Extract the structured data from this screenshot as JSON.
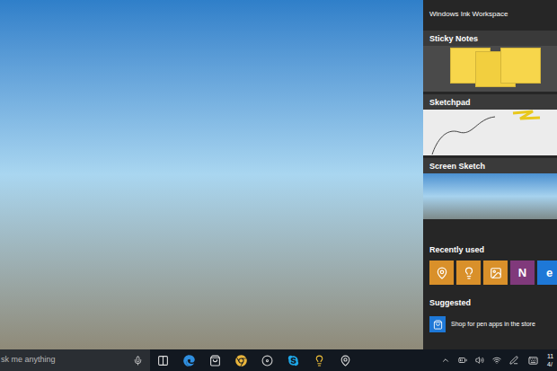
{
  "panel": {
    "title": "Windows Ink Workspace",
    "tiles": [
      {
        "label": "Sticky Notes",
        "kind": "notes"
      },
      {
        "label": "Sketchpad",
        "kind": "sketch"
      },
      {
        "label": "Screen Sketch",
        "kind": "screen"
      }
    ],
    "recently_used": {
      "label": "Recently used",
      "apps": [
        {
          "color": "#d9902a",
          "glyph": ""
        },
        {
          "color": "#d9902a",
          "glyph": ""
        },
        {
          "color": "#d9902a",
          "glyph": ""
        },
        {
          "color": "#80397b",
          "glyph": "N"
        },
        {
          "color": "#1e78d7",
          "glyph": "e"
        }
      ]
    },
    "suggested": {
      "label": "Suggested",
      "items": [
        {
          "text": "Shop for pen apps in the store"
        }
      ]
    }
  },
  "taskbar": {
    "search": {
      "placeholder": "sk me anything"
    },
    "clock": {
      "time": "11",
      "date": "4/"
    }
  }
}
